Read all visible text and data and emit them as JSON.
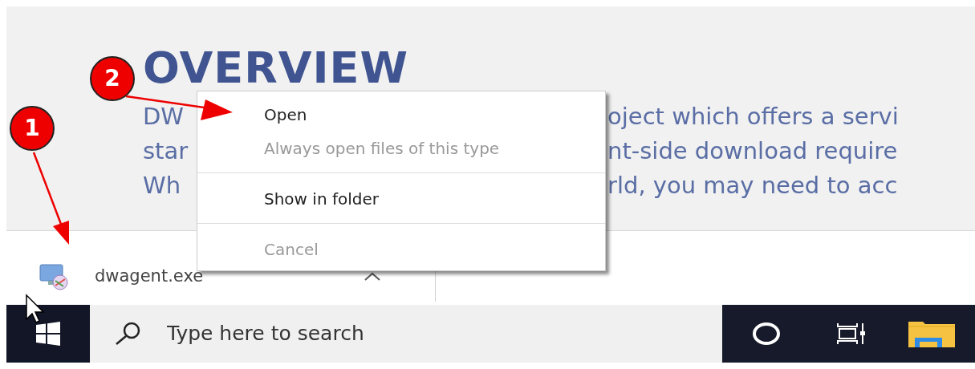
{
  "page": {
    "heading": "OVERVIEW",
    "paragraph_lines": [
      {
        "left": "DW",
        "right": "oject which offers a servi"
      },
      {
        "left": "star",
        "right": "nt-side download require"
      },
      {
        "left": "Wh",
        "right": "rld, you may need to acc"
      }
    ]
  },
  "download_bar": {
    "file_name": "dwagent.exe"
  },
  "context_menu": {
    "items": [
      {
        "kind": "item",
        "label": "Open",
        "disabled": false
      },
      {
        "kind": "item",
        "label": "Always open files of this type",
        "disabled": true
      },
      {
        "kind": "separator"
      },
      {
        "kind": "item",
        "label": "Show in folder",
        "disabled": false
      },
      {
        "kind": "separator"
      },
      {
        "kind": "item",
        "label": "Cancel",
        "disabled": true
      }
    ]
  },
  "taskbar": {
    "search": {
      "placeholder": "Type here to search"
    }
  },
  "annotations": [
    {
      "label": "1"
    },
    {
      "label": "2"
    }
  ]
}
